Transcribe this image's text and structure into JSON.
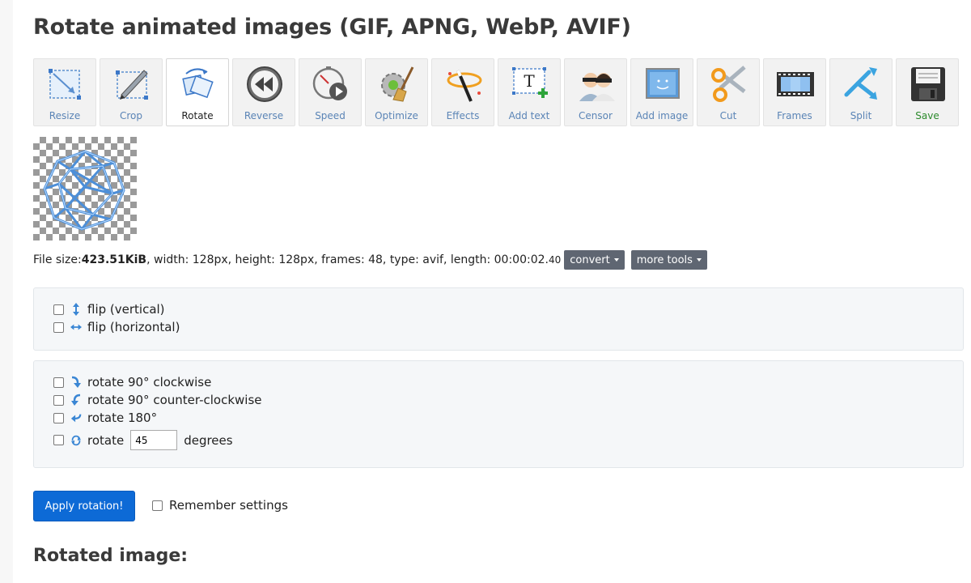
{
  "page": {
    "title": "Rotate animated images (GIF, APNG, WebP, AVIF)"
  },
  "toolbar": [
    {
      "id": "resize",
      "label": "Resize",
      "icon": "resize-icon"
    },
    {
      "id": "crop",
      "label": "Crop",
      "icon": "crop-icon"
    },
    {
      "id": "rotate",
      "label": "Rotate",
      "icon": "rotate-icon",
      "active": true
    },
    {
      "id": "reverse",
      "label": "Reverse",
      "icon": "reverse-icon"
    },
    {
      "id": "speed",
      "label": "Speed",
      "icon": "speed-icon"
    },
    {
      "id": "optimize",
      "label": "Optimize",
      "icon": "optimize-icon"
    },
    {
      "id": "effects",
      "label": "Effects",
      "icon": "effects-icon"
    },
    {
      "id": "addtext",
      "label": "Add text",
      "icon": "add-text-icon"
    },
    {
      "id": "censor",
      "label": "Censor",
      "icon": "censor-icon"
    },
    {
      "id": "addimage",
      "label": "Add image",
      "icon": "add-image-icon"
    },
    {
      "id": "cut",
      "label": "Cut",
      "icon": "cut-icon"
    },
    {
      "id": "frames",
      "label": "Frames",
      "icon": "frames-icon"
    },
    {
      "id": "split",
      "label": "Split",
      "icon": "split-icon"
    },
    {
      "id": "save",
      "label": "Save",
      "icon": "save-icon"
    }
  ],
  "fileinfo": {
    "size_label": "File size: ",
    "size_value": "423.51KiB",
    "details": ", width: 128px, height: 128px, frames: 48, type: avif, length: 00:00:02.",
    "length_fraction": "40",
    "convert_label": "convert",
    "more_tools_label": "more tools"
  },
  "flip": {
    "vertical": "flip (vertical)",
    "horizontal": "flip (horizontal)"
  },
  "rotate": {
    "cw": "rotate 90° clockwise",
    "ccw": "rotate 90° counter-clockwise",
    "r180": "rotate 180°",
    "custom_prefix": "rotate",
    "custom_value": "45",
    "custom_suffix": "degrees"
  },
  "actions": {
    "apply_label": "Apply rotation!",
    "remember_label": "Remember settings"
  },
  "result": {
    "heading": "Rotated image:"
  },
  "colors": {
    "accent": "#0d6ad6",
    "tool_label": "#5a84b6",
    "save_label": "#2c8a2c"
  }
}
